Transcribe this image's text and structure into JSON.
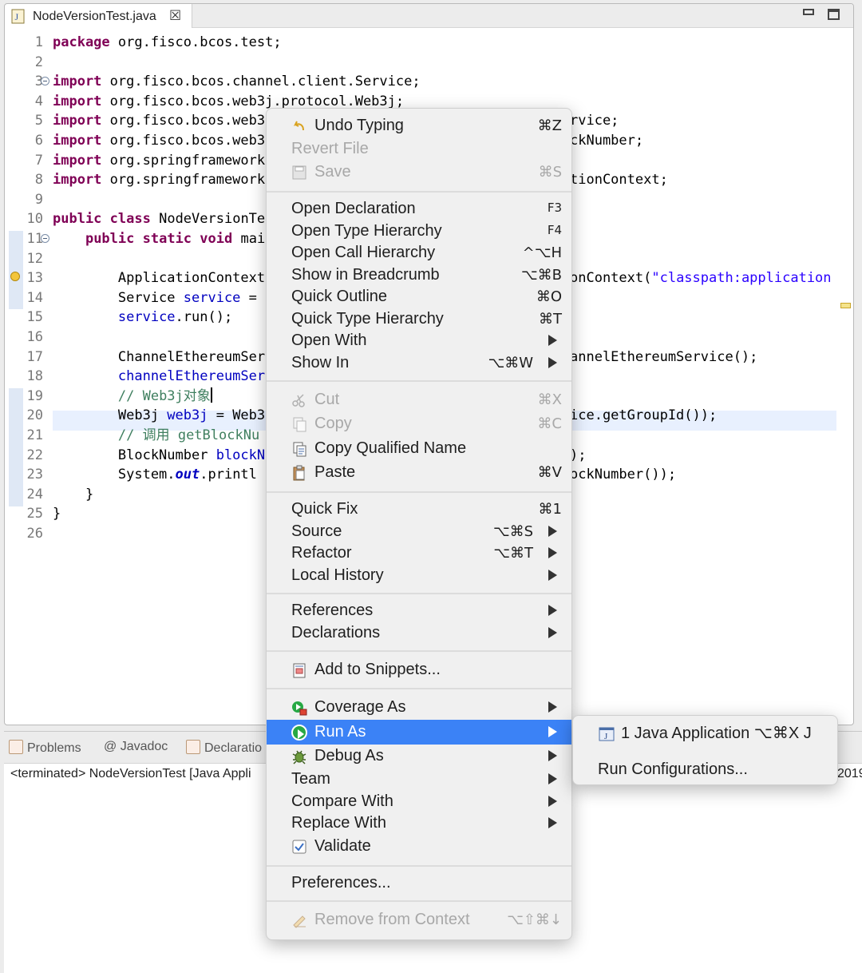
{
  "editor": {
    "tab_label": "NodeVersionTest.java",
    "tab_icon": "java-file-icon",
    "close_glyph": "☒",
    "lines": [
      {
        "n": "1",
        "tokens": [
          {
            "t": "package",
            "c": "kw"
          },
          {
            "t": " org.fisco.bcos.test;",
            "c": ""
          }
        ]
      },
      {
        "n": "2",
        "tokens": []
      },
      {
        "n": "3",
        "fold": true,
        "tokens": [
          {
            "t": "import",
            "c": "kw"
          },
          {
            "t": " org.fisco.bcos.channel.client.Service;",
            "c": ""
          }
        ]
      },
      {
        "n": "4",
        "tokens": [
          {
            "t": "import",
            "c": "kw"
          },
          {
            "t": " org.fisco.bcos.web3j.protocol.Web3j;",
            "c": ""
          }
        ]
      },
      {
        "n": "5",
        "tokens": [
          {
            "t": "import",
            "c": "kw"
          },
          {
            "t": " org.fisco.bcos.web3",
            "c": ""
          }
        ]
      },
      {
        "n": "6",
        "tokens": [
          {
            "t": "import",
            "c": "kw"
          },
          {
            "t": " org.fisco.bcos.web3",
            "c": ""
          }
        ]
      },
      {
        "n": "7",
        "tokens": [
          {
            "t": "import",
            "c": "kw"
          },
          {
            "t": " org.springframework",
            "c": ""
          }
        ]
      },
      {
        "n": "8",
        "tokens": [
          {
            "t": "import",
            "c": "kw"
          },
          {
            "t": " org.springframework",
            "c": ""
          }
        ]
      },
      {
        "n": "9",
        "tokens": []
      },
      {
        "n": "10",
        "tokens": [
          {
            "t": "public",
            "c": "kw"
          },
          {
            "t": " ",
            "c": ""
          },
          {
            "t": "class",
            "c": "kw"
          },
          {
            "t": " NodeVersionTe",
            "c": ""
          }
        ]
      },
      {
        "n": "11",
        "fold": true,
        "tokens": [
          {
            "t": "    ",
            "c": ""
          },
          {
            "t": "public",
            "c": "kw"
          },
          {
            "t": " ",
            "c": ""
          },
          {
            "t": "static",
            "c": "kw"
          },
          {
            "t": " ",
            "c": ""
          },
          {
            "t": "void",
            "c": "kw"
          },
          {
            "t": " mai",
            "c": ""
          }
        ]
      },
      {
        "n": "12",
        "tokens": []
      },
      {
        "n": "13",
        "warn": true,
        "tokens": [
          {
            "t": "        ApplicationContext",
            "c": ""
          }
        ]
      },
      {
        "n": "14",
        "tokens": [
          {
            "t": "        Service ",
            "c": ""
          },
          {
            "t": "service",
            "c": "fld"
          },
          {
            "t": " =",
            "c": ""
          }
        ]
      },
      {
        "n": "15",
        "tokens": [
          {
            "t": "        ",
            "c": ""
          },
          {
            "t": "service",
            "c": "fld"
          },
          {
            "t": ".run();",
            "c": ""
          }
        ]
      },
      {
        "n": "16",
        "tokens": []
      },
      {
        "n": "17",
        "tokens": [
          {
            "t": "        ChannelEthereumSer",
            "c": ""
          }
        ]
      },
      {
        "n": "18",
        "tokens": [
          {
            "t": "        ",
            "c": ""
          },
          {
            "t": "channelEthereumSer",
            "c": "fld"
          }
        ]
      },
      {
        "n": "19",
        "caret": true,
        "tokens": [
          {
            "t": "        ",
            "c": ""
          },
          {
            "t": "// Web3j对象",
            "c": "cm"
          }
        ]
      },
      {
        "n": "20",
        "tokens": [
          {
            "t": "        Web3j ",
            "c": ""
          },
          {
            "t": "web3j",
            "c": "fld"
          },
          {
            "t": " = Web3",
            "c": ""
          }
        ]
      },
      {
        "n": "21",
        "tokens": [
          {
            "t": "        ",
            "c": ""
          },
          {
            "t": "// 调用 getBlockNu",
            "c": "cm"
          }
        ]
      },
      {
        "n": "22",
        "tokens": [
          {
            "t": "        BlockNumber ",
            "c": ""
          },
          {
            "t": "blockN",
            "c": "fld"
          }
        ]
      },
      {
        "n": "23",
        "tokens": [
          {
            "t": "        System.",
            "c": ""
          },
          {
            "t": "out",
            "c": "st"
          },
          {
            "t": ".printl",
            "c": ""
          }
        ]
      },
      {
        "n": "24",
        "tokens": [
          {
            "t": "    }",
            "c": ""
          }
        ]
      },
      {
        "n": "25",
        "tokens": [
          {
            "t": "}",
            "c": ""
          }
        ]
      },
      {
        "n": "26",
        "tokens": []
      }
    ],
    "right_fragments": [
      {
        "line": 5,
        "tokens": [
          {
            "t": "rvice;",
            "c": ""
          }
        ]
      },
      {
        "line": 6,
        "tokens": [
          {
            "t": "ckNumber;",
            "c": ""
          }
        ]
      },
      {
        "line": 8,
        "tokens": [
          {
            "t": "tionContext;",
            "c": ""
          }
        ]
      },
      {
        "line": 13,
        "tokens": [
          {
            "t": "onContext(",
            "c": ""
          },
          {
            "t": "\"classpath:application",
            "c": "strl"
          }
        ]
      },
      {
        "line": 17,
        "tokens": [
          {
            "t": "annelEthereumService();",
            "c": ""
          }
        ]
      },
      {
        "line": 20,
        "tokens": [
          {
            "t": "ice.getGroupId());",
            "c": ""
          }
        ]
      },
      {
        "line": 22,
        "tokens": [
          {
            "t": ");",
            "c": ""
          }
        ]
      },
      {
        "line": 23,
        "tokens": [
          {
            "t": "ockNumber());",
            "c": ""
          }
        ]
      }
    ]
  },
  "bottom_panel": {
    "tabs": [
      {
        "label": "Problems",
        "icon": "problems-icon"
      },
      {
        "label": "@ Javadoc",
        "icon": ""
      },
      {
        "label": "Declaratio",
        "icon": "declaration-icon"
      }
    ],
    "console_text": "<terminated> NodeVersionTest [Java Appli",
    "console_tail": "2019"
  },
  "context_menu": {
    "groups": [
      [
        {
          "label": "Undo Typing",
          "shortcut": "⌘Z",
          "icon": "undo-icon"
        },
        {
          "label": "Revert File",
          "disabled": true
        },
        {
          "label": "Save",
          "shortcut": "⌘S",
          "icon": "save-icon",
          "disabled": true
        }
      ],
      [
        {
          "label": "Open Declaration",
          "shortcut": "F3"
        },
        {
          "label": "Open Type Hierarchy",
          "shortcut": "F4"
        },
        {
          "label": "Open Call Hierarchy",
          "shortcut": "^⌥H"
        },
        {
          "label": "Show in Breadcrumb",
          "shortcut": "⌥⌘B"
        },
        {
          "label": "Quick Outline",
          "shortcut": "⌘O"
        },
        {
          "label": "Quick Type Hierarchy",
          "shortcut": "⌘T"
        },
        {
          "label": "Open With",
          "submenu": true
        },
        {
          "label": "Show In",
          "shortcut": "⌥⌘W",
          "submenu": true
        }
      ],
      [
        {
          "label": "Cut",
          "shortcut": "⌘X",
          "icon": "cut-icon",
          "disabled": true
        },
        {
          "label": "Copy",
          "shortcut": "⌘C",
          "icon": "copy-icon",
          "disabled": true
        },
        {
          "label": "Copy Qualified Name",
          "icon": "copy-qualified-name-icon"
        },
        {
          "label": "Paste",
          "shortcut": "⌘V",
          "icon": "paste-icon"
        }
      ],
      [
        {
          "label": "Quick Fix",
          "shortcut": "⌘1"
        },
        {
          "label": "Source",
          "shortcut": "⌥⌘S",
          "submenu": true
        },
        {
          "label": "Refactor",
          "shortcut": "⌥⌘T",
          "submenu": true
        },
        {
          "label": "Local History",
          "submenu": true
        }
      ],
      [
        {
          "label": "References",
          "submenu": true
        },
        {
          "label": "Declarations",
          "submenu": true
        }
      ],
      [
        {
          "label": "Add to Snippets...",
          "icon": "snippets-icon"
        }
      ],
      [
        {
          "label": "Coverage As",
          "icon": "coverage-icon",
          "submenu": true
        },
        {
          "label": "Run As",
          "icon": "run-icon",
          "submenu": true,
          "selected": true
        },
        {
          "label": "Debug As",
          "icon": "debug-icon",
          "submenu": true
        },
        {
          "label": "Team",
          "submenu": true
        },
        {
          "label": "Compare With",
          "submenu": true
        },
        {
          "label": "Replace With",
          "submenu": true
        },
        {
          "label": "Validate",
          "icon": "checkbox-checked-icon"
        }
      ],
      [
        {
          "label": "Preferences..."
        }
      ],
      [
        {
          "label": "Remove from Context",
          "shortcut": "⌥⇧⌘↓",
          "icon": "remove-context-icon",
          "disabled": true
        }
      ]
    ]
  },
  "run_as_submenu": {
    "items": [
      {
        "label": "1 Java Application ⌥⌘X J",
        "icon": "java-application-icon"
      },
      {
        "label": "Run Configurations..."
      }
    ]
  },
  "colors": {
    "selection": "#3b82f6",
    "keyword": "#7f0055",
    "field": "#0000c0",
    "comment": "#3f7f5f",
    "string": "#2a00ff"
  }
}
